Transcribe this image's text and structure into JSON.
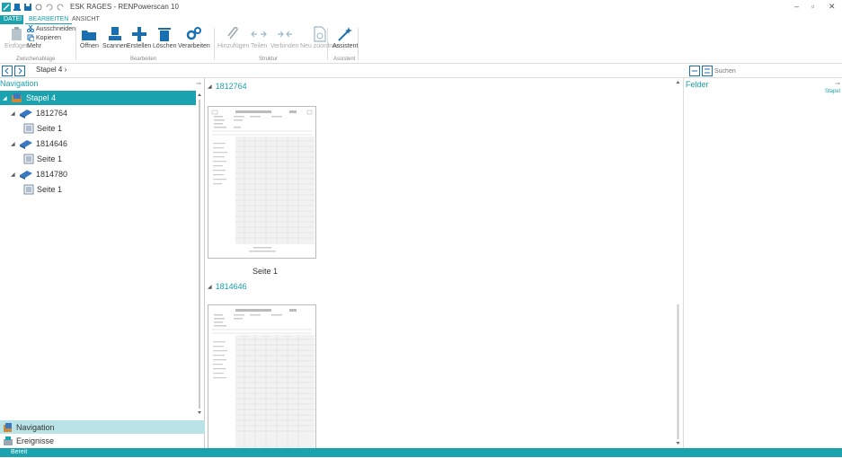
{
  "titlebar": {
    "title": "ESK RAGES - RENPowerscan 10",
    "controls": [
      "–",
      "▫",
      "✕"
    ]
  },
  "tabs": [
    {
      "label": "DATEI"
    },
    {
      "label": "BEARBEITEN"
    },
    {
      "label": "ANSICHT"
    }
  ],
  "ribbon": {
    "einfuegen": "Einfügen",
    "ausschneiden": "Ausschneiden",
    "kopieren": "Kopieren",
    "mehr": "Mehr",
    "grp_zwischenablage": "Zwischenablage",
    "oeffnen": "Öffnen",
    "scannen": "Scannen",
    "erstellen": "Erstellen",
    "loeschen": "Löschen",
    "verarbeiten": "Verarbeiten",
    "grp_bearbeiten": "Bearbeiten",
    "hinzufuegen": "Hinzufügen",
    "teilen": "Teilen",
    "verbinden": "Verbinden",
    "neu_zuordnen": "Neu zuordnen",
    "grp_struktur": "Struktur",
    "assistent": "Assistent",
    "grp_assistent": "Assistent"
  },
  "address": {
    "breadcrumb": "Stapel 4",
    "search_placeholder": "Suchen"
  },
  "navigation": {
    "header": "Navigation",
    "tree": [
      {
        "label": "Stapel 4",
        "level": 0
      },
      {
        "label": "1812764",
        "level": 1
      },
      {
        "label": "Seite 1",
        "level": 2
      },
      {
        "label": "1814646",
        "level": 1
      },
      {
        "label": "Seite 1",
        "level": 2
      },
      {
        "label": "1814780",
        "level": 1
      },
      {
        "label": "Seite 1",
        "level": 2
      }
    ],
    "bottom_nav": "Navigation",
    "bottom_ereignisse": "Ereignisse"
  },
  "documents": [
    {
      "id": "1812764",
      "caption": "Seite 1"
    },
    {
      "id": "1814646",
      "caption": ""
    }
  ],
  "fields": {
    "title": "Felder",
    "stapel": "Stapel"
  },
  "statusbar": {
    "text": "Bereit"
  },
  "colors": {
    "accent": "#1aa3ae",
    "selection_light": "#b9e3e6"
  }
}
